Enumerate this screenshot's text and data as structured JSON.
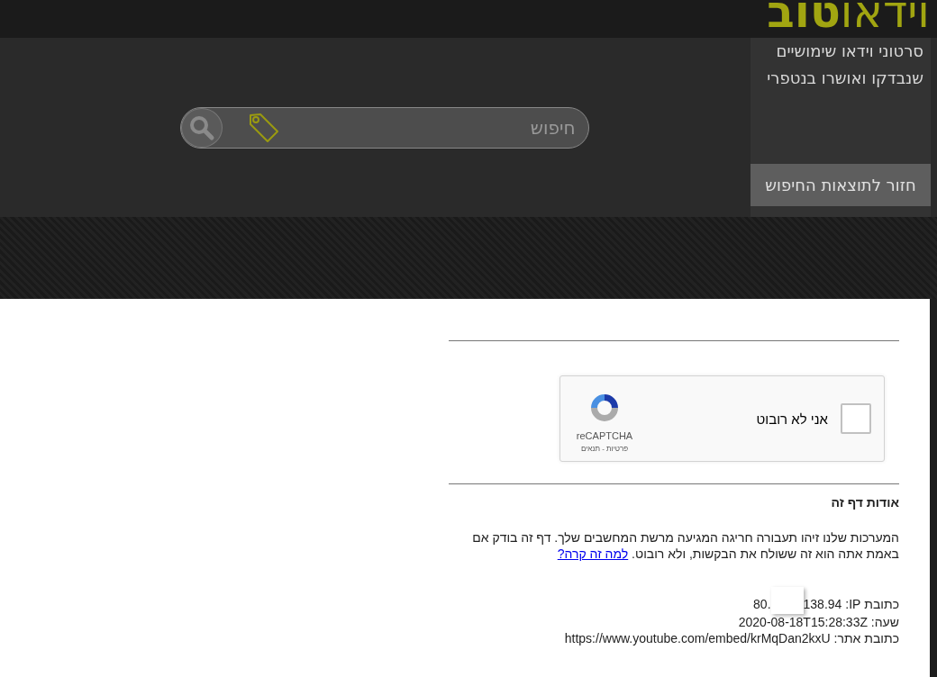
{
  "logo": {
    "light": "וידאו",
    "bold": "טוב"
  },
  "tagline": "סרטוני וידאו שימושיים שנבדקו ואושרו בנטפרי",
  "back_button": "חזור לתוצאות החיפוש",
  "search": {
    "placeholder": "חיפוש"
  },
  "captcha": {
    "label": "אני לא רובוט",
    "checked": false,
    "brand": "reCAPTCHA",
    "links": "פרטיות - תנאים"
  },
  "about": {
    "title": "אודות דף זה",
    "text": "המערכות שלנו זיהו תעבורה חריגה המגיעה מרשת המחשבים שלך. דף זה בודק אם באמת אתה הוא זה ששולח את הבקשות, ולא רובוט.",
    "link": "למה זה קרה?"
  },
  "details": {
    "ip_label": "כתובת IP:",
    "ip_start": "80.",
    "ip_end": "138.94",
    "time": "שעה: 2020-08-18T15:28:33Z",
    "url": "כתובת אתר: https://www.youtube.com/embed/krMqDan2kxU"
  }
}
